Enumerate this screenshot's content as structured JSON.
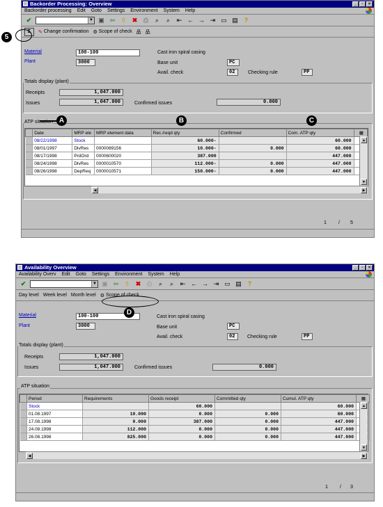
{
  "w1": {
    "title": "Backorder Processing: Overview",
    "menu": [
      "Backorder processing",
      "Edit",
      "Goto",
      "Settings",
      "Environment",
      "System",
      "Help"
    ],
    "appbar": {
      "change": "Change confirmation",
      "scope": "Scope of check"
    },
    "fields": {
      "material_label": "Material",
      "material_value": "100-100",
      "plant_label": "Plant",
      "plant_value": "3000",
      "description": "Cast iron spiral casing",
      "base_unit_label": "Base unit",
      "base_unit_value": "PC",
      "avail_check_label": "Avail. check",
      "avail_check_value": "02",
      "checking_rule_label": "Checking rule",
      "checking_rule_value": "PP"
    },
    "totals": {
      "title": "Totals display (plant)",
      "receipts_label": "Receipts",
      "receipts_value": "1,047.000",
      "issues_label": "Issues",
      "issues_value": "1,047.000",
      "confirmed_label": "Confirmed issues",
      "confirmed_value": "0.000"
    },
    "atp": {
      "title": "ATP situation",
      "headers": [
        "Date",
        "MRP ele",
        "MRP element data",
        "Rec./reqd qty",
        "Confirmed",
        "Com. ATP qty"
      ],
      "rows": [
        [
          "08/22/1998",
          "Stock",
          "",
          "60.000-",
          "",
          "60.000"
        ],
        [
          "08/01/1997",
          "DlvRes",
          "0000089156",
          "10.000-",
          "0.000",
          "60.000"
        ],
        [
          "08/17/1998",
          "PrdOrd",
          "0000600020",
          "387.000",
          "",
          "447.000"
        ],
        [
          "08/24/1998",
          "DlvRes",
          "0000010570",
          "112.000-",
          "0.000",
          "447.000"
        ],
        [
          "08/26/1998",
          "DepReq",
          "0000010571",
          "150.000-",
          "0.000",
          "447.000"
        ]
      ]
    },
    "pager": {
      "current": "1",
      "sep": "/",
      "total": "5"
    }
  },
  "w2": {
    "title": "Availability Overview",
    "menu": [
      "Availability Overv",
      "Edit",
      "Goto",
      "Settings",
      "Environment",
      "System",
      "Help"
    ],
    "appbar": {
      "day": "Day level",
      "week": "Week level",
      "month": "Month level",
      "scope": "Scope of check"
    },
    "fields": {
      "material_label": "Material",
      "material_value": "100-100",
      "plant_label": "Plant",
      "plant_value": "3000",
      "description": "Cast iron spiral casing",
      "base_unit_label": "Base unit",
      "base_unit_value": "PC",
      "avail_check_label": "Avail. check",
      "avail_check_value": "02",
      "checking_rule_label": "Checking rule",
      "checking_rule_value": "PP"
    },
    "totals": {
      "title": "Totals display (plant)",
      "receipts_label": "Receipts",
      "receipts_value": "1,047.000",
      "issues_label": "Issues",
      "issues_value": "1,047.000",
      "confirmed_label": "Confirmed issues",
      "confirmed_value": "0.000"
    },
    "atp": {
      "title": "ATP situation",
      "headers": [
        "Period",
        "Requirements",
        "Goods receipt",
        "Committed qty",
        "Cumul. ATP qty"
      ],
      "rows": [
        [
          "Stock",
          "",
          "60.000",
          "",
          "60.000"
        ],
        [
          "01.08.1997",
          "10.000",
          "0.000",
          "0.000",
          "60.000"
        ],
        [
          "17.08.1998",
          "0.000",
          "387.000",
          "0.000",
          "447.000"
        ],
        [
          "24.08.1998",
          "112.000",
          "0.000",
          "0.000",
          "447.000"
        ],
        [
          "26.08.1998",
          "825.000",
          "0.000",
          "0.000",
          "447.000"
        ]
      ]
    },
    "pager": {
      "current": "1",
      "sep": "/",
      "total": "3"
    }
  },
  "callouts": {
    "five": "5",
    "a": "A",
    "b": "B",
    "c": "C",
    "d": "D"
  },
  "icons": {
    "check": "check-icon",
    "save": "save-icon",
    "back": "back-icon",
    "exit": "exit-icon",
    "cancel": "cancel-icon",
    "print": "print-icon",
    "find": "find-icon",
    "help": "help-icon"
  }
}
